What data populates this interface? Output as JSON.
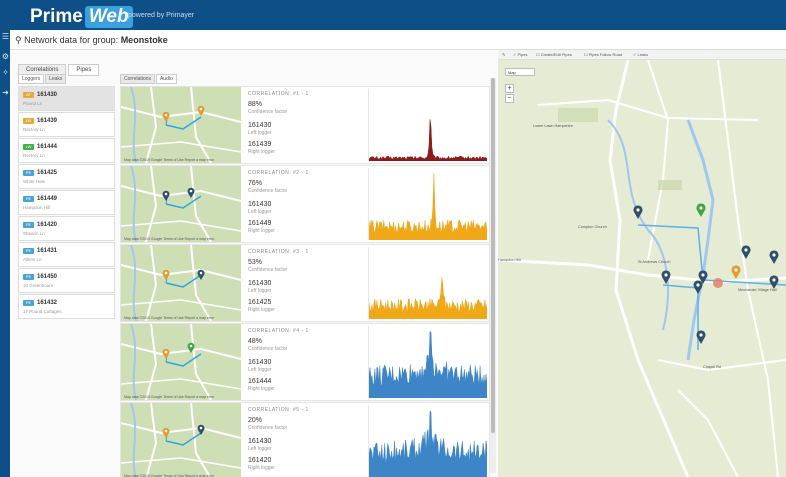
{
  "header": {
    "brand_a": "Prime",
    "brand_b": "Web",
    "powered": "powered by Primayer"
  },
  "titlebar": {
    "prefix": "Network data for group:",
    "group": "Meonstoke"
  },
  "tabs": [
    "Correlations",
    "Pipes"
  ],
  "logger_subtabs": [
    "Loggers",
    "Leaks"
  ],
  "corr_subtabs": [
    "Correlations",
    "Audio"
  ],
  "loggers": [
    {
      "badge": "AT",
      "badge_color": "#e6a93a",
      "id": "161430",
      "sub": "Pound Ln",
      "selected": true
    },
    {
      "badge": "LB",
      "badge_color": "#e6a93a",
      "id": "161439",
      "sub": "Rectory Ln",
      "selected": false
    },
    {
      "badge": "LW",
      "badge_color": "#3db04a",
      "id": "161444",
      "sub": "Rectory Ln",
      "selected": false
    },
    {
      "badge": "PE",
      "badge_color": "#4aa2d6",
      "id": "161425",
      "sub": "White Hole",
      "selected": false
    },
    {
      "badge": "PE",
      "badge_color": "#4aa2d6",
      "id": "161449",
      "sub": "Hampdon Hill",
      "selected": false
    },
    {
      "badge": "PE",
      "badge_color": "#4aa2d6",
      "id": "161420",
      "sub": "Shearin Ln",
      "selected": false
    },
    {
      "badge": "PE",
      "badge_color": "#4aa2d6",
      "id": "161431",
      "sub": "Allens Ln",
      "selected": false
    },
    {
      "badge": "PE",
      "badge_color": "#4aa2d6",
      "id": "161450",
      "sub": "10 Greenbourn",
      "selected": false
    },
    {
      "badge": "PE",
      "badge_color": "#4aa2d6",
      "id": "161432",
      "sub": "17 Pound Cottages",
      "selected": false
    }
  ],
  "correlations": [
    {
      "head": "CORRELATION: #1 - 1",
      "pct": "88%",
      "conf": "Confidence factor",
      "left": "161430",
      "left_label": "Left logger",
      "right": "161439",
      "right_label": "Right logger",
      "color": "#8a1c1c"
    },
    {
      "head": "CORRELATION: #2 - 1",
      "pct": "76%",
      "conf": "Confidence factor",
      "left": "161430",
      "left_label": "Left logger",
      "right": "161449",
      "right_label": "Right logger",
      "color": "#f0a818"
    },
    {
      "head": "CORRELATION: #3 - 1",
      "pct": "53%",
      "conf": "Confidence factor",
      "left": "161430",
      "left_label": "Left logger",
      "right": "161425",
      "right_label": "Right logger",
      "color": "#f0a818"
    },
    {
      "head": "CORRELATION: #4 - 1",
      "pct": "48%",
      "conf": "Confidence factor",
      "left": "161430",
      "left_label": "Left logger",
      "right": "161444",
      "right_label": "Right logger",
      "color": "#3d85c6"
    },
    {
      "head": "CORRELATION: #5 - 1",
      "pct": "20%",
      "conf": "Confidence factor",
      "left": "161430",
      "left_label": "Left logger",
      "right": "161420",
      "right_label": "Right logger",
      "color": "#3d85c6"
    }
  ],
  "map_footer": "Map data ©2019 Google   Terms of Use   Report a map error",
  "mapbar": {
    "pipes": "Pipes",
    "create_edit": "Create/Edit Pipes",
    "follow_road": "Pipes Follow Road",
    "leaks": "Leaks"
  },
  "bigmap": {
    "select": "Map",
    "labels": [
      "Lower Lawn Hampshire",
      "Compton Church",
      "St Andrews Church",
      "Meonstoke Village Hall",
      "Chapel Rd",
      "Hampdon Hill"
    ]
  }
}
